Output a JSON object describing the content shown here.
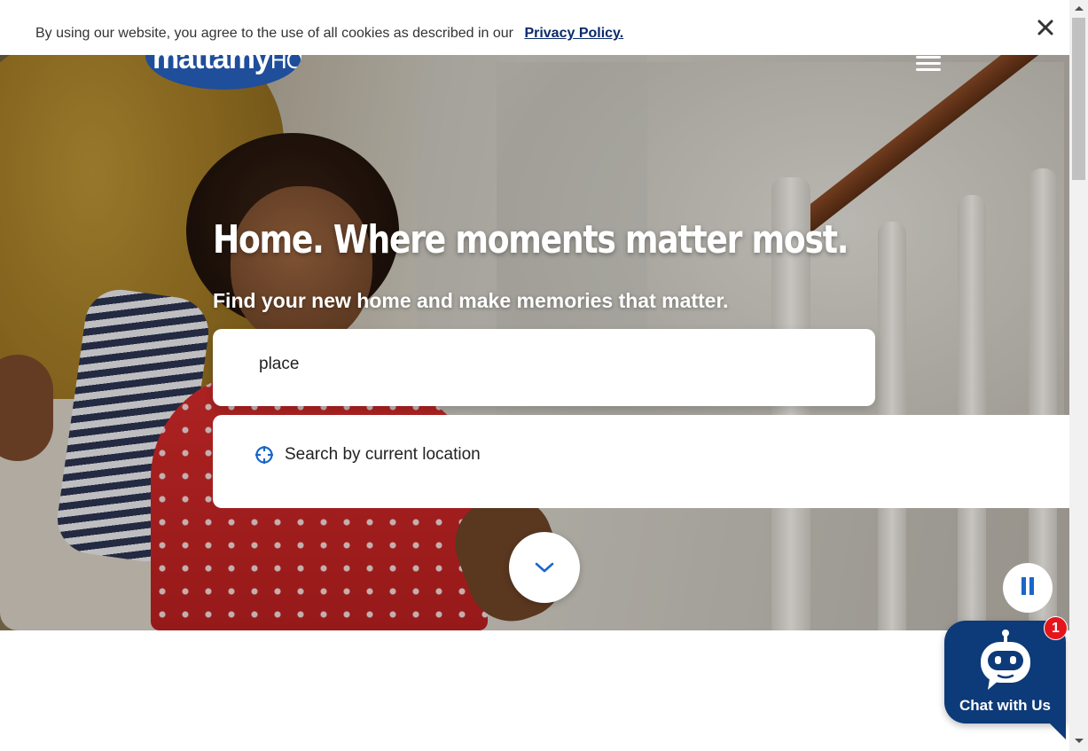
{
  "cookie_banner": {
    "text": "By using our website, you agree to the use of all cookies as described in our",
    "link_label": "Privacy Policy.",
    "close_icon": "close-icon"
  },
  "header": {
    "logo_main": "mattamy",
    "logo_sub": "HOMES",
    "menu_icon": "hamburger-menu-icon"
  },
  "hero": {
    "headline": "Home. Where moments matter most.",
    "subheadline": "Find your new home and make memories that matter.",
    "search_value": "place",
    "location_label": "Search by current location"
  },
  "controls": {
    "scroll_icon": "chevron-down-icon",
    "pause_icon": "pause-icon"
  },
  "chat": {
    "label": "Chat with Us",
    "badge_count": "1",
    "icon": "chatbot-icon"
  },
  "colors": {
    "brand_blue": "#1f4e9b",
    "link_navy": "#0b2a6b",
    "accent_blue": "#1a66c9",
    "chat_bg": "#0d3a78",
    "badge_red": "#e4151b"
  }
}
